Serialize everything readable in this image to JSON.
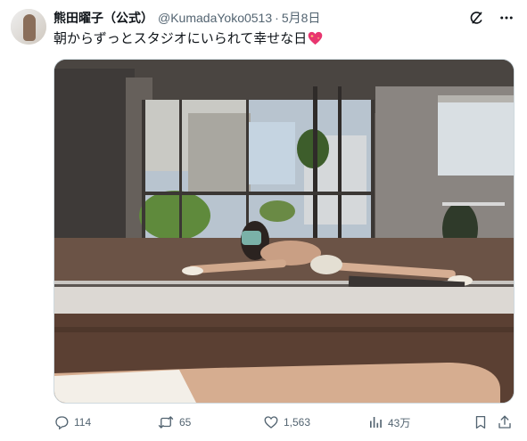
{
  "author": {
    "display_name": "熊田曜子（公式）",
    "handle": "@KumadaYoko0513",
    "separator": "·",
    "date": "5月8日"
  },
  "post": {
    "text": "朝からずっとスタジオにいられて幸せな日"
  },
  "icons": {
    "grok": "grok-icon",
    "more": "more-icon",
    "reply": "reply-icon",
    "repost": "repost-icon",
    "like": "like-icon",
    "views": "views-icon",
    "bookmark": "bookmark-icon",
    "share": "share-icon",
    "emoji": "sparkling-heart-icon"
  },
  "metrics": {
    "replies": "114",
    "reposts": "65",
    "likes": "1,563",
    "views": "43万"
  },
  "colors": {
    "text": "#0f1419",
    "secondary": "#536471",
    "heart": "#e8366f"
  }
}
